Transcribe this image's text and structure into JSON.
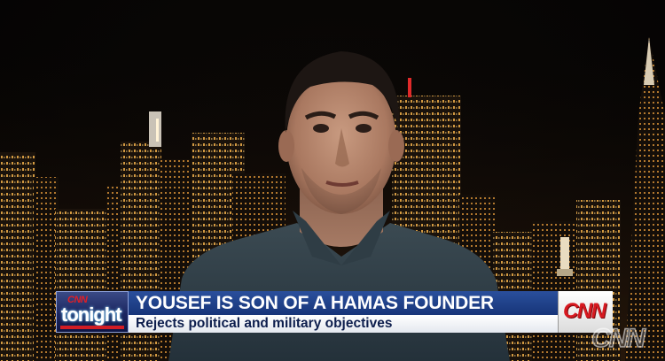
{
  "lower_third": {
    "show_logo": {
      "network": "CNN",
      "show": "tonight"
    },
    "headline": "YOUSEF IS SON OF A HAMAS FOUNDER",
    "subheadline": "Rejects political and military objectives",
    "network_badge": "CNN"
  },
  "watermark": "CNN",
  "colors": {
    "headline_bg": "#1f3f8a",
    "subhead_bg": "#f2f4f7",
    "brand_red": "#d71920",
    "city_lights": "#f3b24a"
  }
}
